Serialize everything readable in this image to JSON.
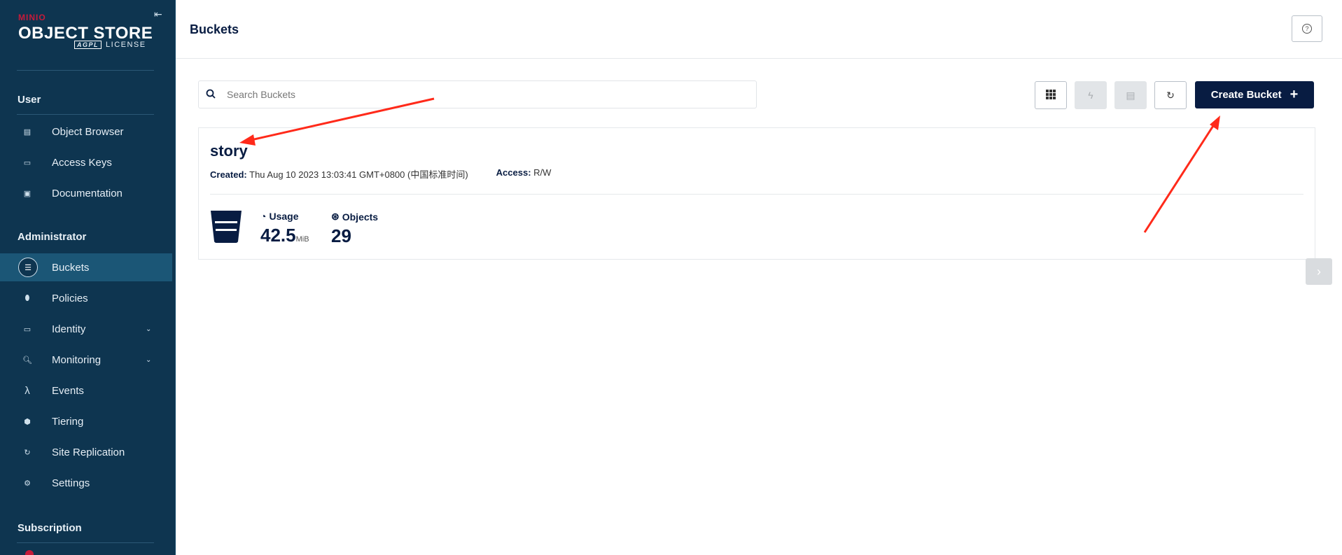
{
  "brand": {
    "logo_text": "MINIO",
    "product": "OBJECT STORE",
    "license_badge": "AGPL",
    "license_label": "LICENSE"
  },
  "sidebar": {
    "sections": {
      "user": "User",
      "administrator": "Administrator",
      "subscription": "Subscription"
    },
    "user_items": [
      {
        "label": "Object Browser",
        "icon": "object-browser-icon"
      },
      {
        "label": "Access Keys",
        "icon": "key-card-icon"
      },
      {
        "label": "Documentation",
        "icon": "docs-icon"
      }
    ],
    "admin_items": [
      {
        "label": "Buckets",
        "icon": "bucket-icon",
        "active": true
      },
      {
        "label": "Policies",
        "icon": "shield-icon"
      },
      {
        "label": "Identity",
        "icon": "id-card-icon",
        "expandable": true
      },
      {
        "label": "Monitoring",
        "icon": "monitor-search-icon",
        "expandable": true
      },
      {
        "label": "Events",
        "icon": "lambda-icon"
      },
      {
        "label": "Tiering",
        "icon": "stack-icon"
      },
      {
        "label": "Site Replication",
        "icon": "sync-icon"
      },
      {
        "label": "Settings",
        "icon": "gear-icon"
      }
    ]
  },
  "header": {
    "title": "Buckets"
  },
  "search": {
    "placeholder": "Search Buckets",
    "value": ""
  },
  "toolbar": {
    "create_label": "Create Bucket"
  },
  "buckets": [
    {
      "name": "story",
      "created_label": "Created:",
      "created": "Thu Aug 10 2023 13:03:41 GMT+0800 (中国标准时间)",
      "access_label": "Access:",
      "access": "R/W",
      "usage_label": "Usage",
      "usage_value": "42.5",
      "usage_unit": "MiB",
      "objects_label": "Objects",
      "objects_value": "29"
    }
  ],
  "colors": {
    "sidebar": "#0e3550",
    "accent": "#081c42",
    "brand_red": "#c51b3a",
    "annotation_arrow": "#ff2a1a"
  }
}
